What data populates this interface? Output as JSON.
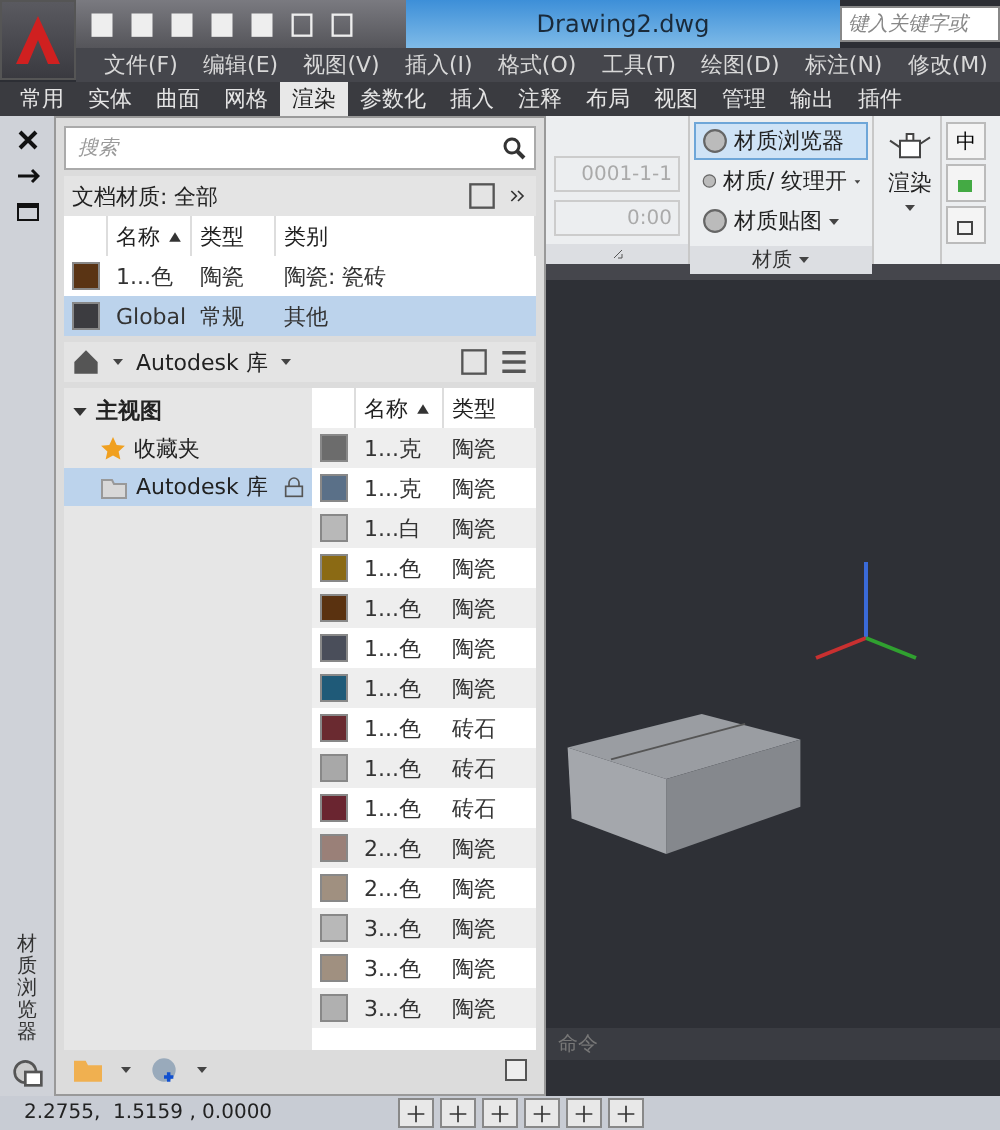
{
  "title": "Drawing2.dwg",
  "search": {
    "placeholder": "键入关键字或"
  },
  "menu": [
    "文件(F)",
    "编辑(E)",
    "视图(V)",
    "插入(I)",
    "格式(O)",
    "工具(T)",
    "绘图(D)",
    "标注(N)",
    "修改(M)"
  ],
  "ribbon_tabs": [
    {
      "label": "常用",
      "selected": false
    },
    {
      "label": "实体",
      "selected": false
    },
    {
      "label": "曲面",
      "selected": false
    },
    {
      "label": "网格",
      "selected": false
    },
    {
      "label": "渲染",
      "selected": true
    },
    {
      "label": "参数化",
      "selected": false
    },
    {
      "label": "插入",
      "selected": false
    },
    {
      "label": "注释",
      "selected": false
    },
    {
      "label": "布局",
      "selected": false
    },
    {
      "label": "视图",
      "selected": false
    },
    {
      "label": "管理",
      "selected": false
    },
    {
      "label": "输出",
      "selected": false
    },
    {
      "label": "插件",
      "selected": false
    }
  ],
  "palette": {
    "title": "材质浏览器",
    "search_placeholder": "搜索",
    "doc_filter": "文档材质: 全部",
    "doc_columns": [
      "名称",
      "类型",
      "类别"
    ],
    "doc_rows": [
      {
        "name": "1...色",
        "type": "陶瓷",
        "category": "陶瓷: 瓷砖",
        "color": "#5a3414",
        "selected": false
      },
      {
        "name": "Global",
        "type": "常规",
        "category": "其他",
        "color": "#3c3c40",
        "selected": true
      }
    ],
    "library_path": "Autodesk 库",
    "tree": [
      {
        "label": "主视图",
        "expanded": true,
        "children": [
          {
            "label": "收藏夹",
            "kind": "favorites",
            "selected": false
          },
          {
            "label": "Autodesk 库",
            "kind": "library",
            "selected": true
          }
        ]
      }
    ],
    "lib_columns": [
      "名称",
      "类型"
    ],
    "lib_rows": [
      {
        "name": "1...克",
        "type": "陶瓷",
        "color": "#6c6c6c"
      },
      {
        "name": "1...克",
        "type": "陶瓷",
        "color": "#5a7088"
      },
      {
        "name": "1...白",
        "type": "陶瓷",
        "color": "#b8b8b8"
      },
      {
        "name": "1...色",
        "type": "陶瓷",
        "color": "#8b6a14"
      },
      {
        "name": "1...色",
        "type": "陶瓷",
        "color": "#5a3210"
      },
      {
        "name": "1...色",
        "type": "陶瓷",
        "color": "#4a4e5a"
      },
      {
        "name": "1...色",
        "type": "陶瓷",
        "color": "#1f5a78"
      },
      {
        "name": "1...色",
        "type": "砖石",
        "color": "#6a2a30"
      },
      {
        "name": "1...色",
        "type": "砖石",
        "color": "#a8a8a8"
      },
      {
        "name": "1...色",
        "type": "砖石",
        "color": "#6a2530"
      },
      {
        "name": "2...色",
        "type": "陶瓷",
        "color": "#9a8078"
      },
      {
        "name": "2...色",
        "type": "陶瓷",
        "color": "#a09080"
      },
      {
        "name": "3...色",
        "type": "陶瓷",
        "color": "#b8b8b8"
      },
      {
        "name": "3...色",
        "type": "陶瓷",
        "color": "#a09080"
      },
      {
        "name": "3...色",
        "type": "陶瓷",
        "color": "#b0b0b0"
      }
    ]
  },
  "ribbon": {
    "date_fields": [
      "0001-1-1",
      "0:00"
    ],
    "material_panel": {
      "title": "材质",
      "buttons": [
        {
          "label": "材质浏览器",
          "on": true,
          "dropdown": false
        },
        {
          "label": "材质/ 纹理开",
          "on": false,
          "dropdown": true
        },
        {
          "label": "材质贴图",
          "on": false,
          "dropdown": true
        }
      ]
    },
    "render_button": "渲染",
    "quality": "中"
  },
  "command_line": "命令",
  "status_coords": "2.2755,  1.5159 , 0.0000"
}
